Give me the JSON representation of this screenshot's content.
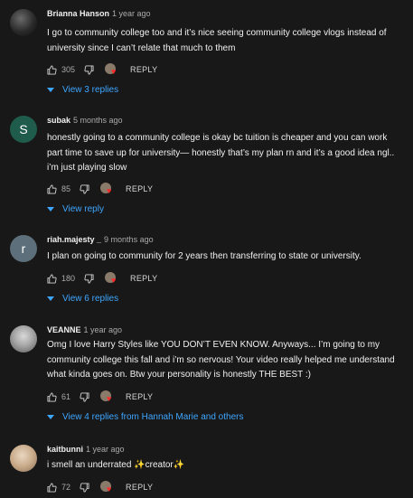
{
  "comments": [
    {
      "author": "Brianna Hanson",
      "time": "1 year ago",
      "text": "I go to community college too and it’s nice seeing community college vlogs instead of university since I can’t relate that much to them",
      "likes": "305",
      "reply_label": "REPLY",
      "view_replies": "View 3 replies",
      "avatar_letter": ""
    },
    {
      "author": "subak",
      "time": "5 months ago",
      "text": "honestly going to a community college is okay bc tuition is cheaper and you can work part time to save up for university— honestly that’s my plan rn and it’s a good idea ngl.. i’m just playing slow",
      "likes": "85",
      "reply_label": "REPLY",
      "view_replies": "View reply",
      "avatar_letter": "S"
    },
    {
      "author": "riah.majesty _",
      "time": "9 months ago",
      "text": "I plan on going to community for 2 years then transferring to state or university.",
      "likes": "180",
      "reply_label": "REPLY",
      "view_replies": "View 6 replies",
      "avatar_letter": "r"
    },
    {
      "author": "VEANNE",
      "time": "1 year ago",
      "text": "Omg I love Harry Styles like YOU DON’T EVEN KNOW. Anyways... I’m going to my community college this fall and i’m so nervous! Your video really helped me understand what kinda goes on. Btw your personality is honestly THE BEST :)",
      "likes": "61",
      "reply_label": "REPLY",
      "view_replies": "View 4 replies from Hannah Marie and others",
      "avatar_letter": ""
    },
    {
      "author": "kaitbunni",
      "time": "1 year ago",
      "text": "i smell an underrated ✨creator✨",
      "likes": "72",
      "reply_label": "REPLY",
      "avatar_letter": ""
    }
  ],
  "icons": {
    "like": "thumbs-up-icon",
    "dislike": "thumbs-down-icon",
    "heart": "creator-heart-icon",
    "chevron": "chevron-down-icon"
  },
  "colors": {
    "background": "#181818",
    "link": "#3ea6ff",
    "heart": "#ff2a2a"
  }
}
